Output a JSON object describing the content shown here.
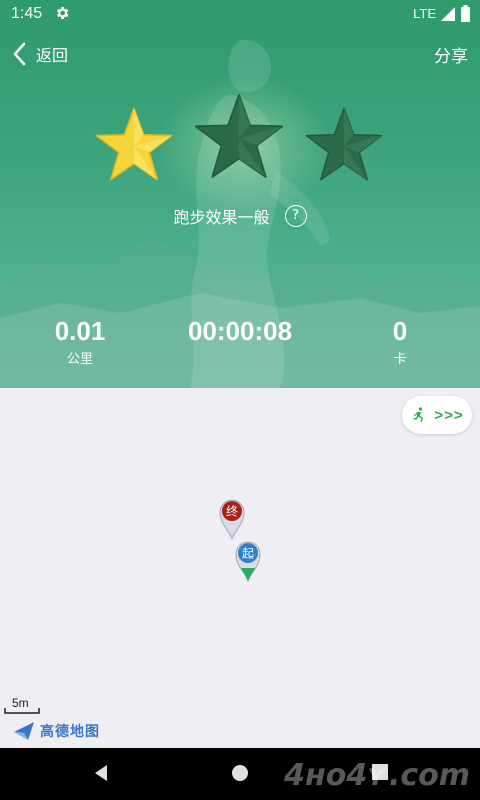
{
  "status_bar": {
    "time": "1:45",
    "network": "LTE"
  },
  "header": {
    "back_label": "返回",
    "share_label": "分享"
  },
  "rating": {
    "stars_earned": 1,
    "stars_total": 3
  },
  "effect": {
    "text": "跑步效果一般",
    "help": "?"
  },
  "stats": {
    "distance": {
      "value": "0.01",
      "unit": "公里"
    },
    "duration": {
      "value": "00:00:08"
    },
    "calories": {
      "value": "0",
      "unit": "卡"
    }
  },
  "map": {
    "run_mode_label": ">>>",
    "end_marker": "终",
    "start_marker": "起",
    "scale_label": "5m",
    "logo_text": "高德地图"
  },
  "watermark": "4ʜᴏ4ʏ.com",
  "colors": {
    "hero_green": "#3aa37a",
    "star_gold": "#f5d53a",
    "star_dark": "#2c6b4a",
    "accent_green": "#2bab5a",
    "end_marker": "#a8201a",
    "start_marker": "#2f7fc9"
  }
}
